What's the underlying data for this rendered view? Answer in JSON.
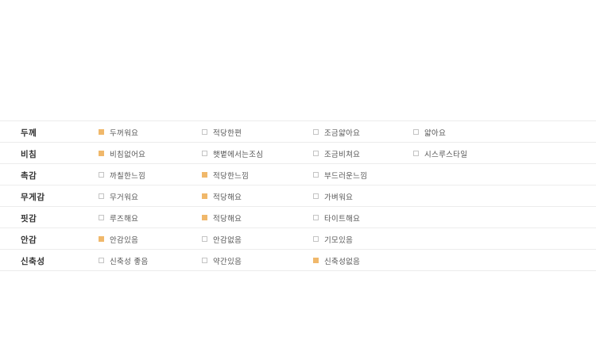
{
  "accent_color": "#f0b86b",
  "rows": [
    {
      "label": "두께",
      "options": [
        {
          "text": "두꺼워요",
          "selected": true
        },
        {
          "text": "적당한편",
          "selected": false
        },
        {
          "text": "조금얇아요",
          "selected": false
        },
        {
          "text": "얇아요",
          "selected": false
        }
      ]
    },
    {
      "label": "비침",
      "options": [
        {
          "text": "비침없어요",
          "selected": true
        },
        {
          "text": "햇볕에서는조심",
          "selected": false
        },
        {
          "text": "조금비쳐요",
          "selected": false
        },
        {
          "text": "시스루스타일",
          "selected": false
        }
      ]
    },
    {
      "label": "촉감",
      "options": [
        {
          "text": "까칠한느낌",
          "selected": false
        },
        {
          "text": "적당한느낌",
          "selected": true
        },
        {
          "text": "부드러운느낌",
          "selected": false
        }
      ]
    },
    {
      "label": "무게감",
      "options": [
        {
          "text": "무거워요",
          "selected": false
        },
        {
          "text": "적당해요",
          "selected": true
        },
        {
          "text": "가벼워요",
          "selected": false
        }
      ]
    },
    {
      "label": "핏감",
      "options": [
        {
          "text": "루즈해요",
          "selected": false
        },
        {
          "text": "적당해요",
          "selected": true
        },
        {
          "text": "타이트해요",
          "selected": false
        }
      ]
    },
    {
      "label": "안감",
      "options": [
        {
          "text": "안감있음",
          "selected": true
        },
        {
          "text": "안감없음",
          "selected": false
        },
        {
          "text": "기모있음",
          "selected": false
        }
      ]
    },
    {
      "label": "신축성",
      "options": [
        {
          "text": "신축성 좋음",
          "selected": false
        },
        {
          "text": "약간있음",
          "selected": false
        },
        {
          "text": "신축성없음",
          "selected": true
        }
      ]
    }
  ]
}
